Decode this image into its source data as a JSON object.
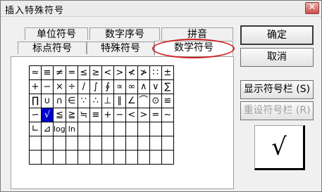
{
  "window": {
    "title": "插入特殊符号",
    "close_glyph": "✕"
  },
  "tabs": [
    {
      "label": "单位符号"
    },
    {
      "label": "数字序号"
    },
    {
      "label": "拼音"
    },
    {
      "label": "标点符号"
    },
    {
      "label": "特殊符号"
    },
    {
      "label": "数学符号",
      "active": true
    }
  ],
  "symbols": [
    [
      "≈",
      "≡",
      "≠",
      "=",
      "≤",
      "≥",
      "<",
      ">",
      "≮",
      "≯",
      "∷",
      "±"
    ],
    [
      "+",
      "−",
      "×",
      "÷",
      "/",
      "∫",
      "∮",
      "∝",
      "∞",
      "∧",
      "∨",
      "∑"
    ],
    [
      "∏",
      "∪",
      "∩",
      "∈",
      "∵",
      "∴",
      "⊥",
      "∥",
      "∠",
      "⌒",
      "⊙",
      "≌"
    ],
    [
      "∽",
      "√",
      "≦",
      "≧",
      "≒",
      "≡",
      "+",
      "−",
      "<",
      ">",
      "=",
      "∼"
    ],
    [
      "∟",
      "⊿",
      "log",
      "ln",
      "",
      "",
      "",
      "",
      "",
      "",
      "",
      ""
    ],
    [
      "",
      "",
      "",
      "",
      "",
      "",
      "",
      "",
      "",
      "",
      "",
      ""
    ],
    [
      "",
      "",
      "",
      "",
      "",
      "",
      "",
      "",
      "",
      "",
      "",
      ""
    ]
  ],
  "selected_symbol": "√",
  "buttons": {
    "ok": "确定",
    "cancel": "取消",
    "show_toolbar": "显示符号栏 (S)",
    "reset_toolbar": "重设符号栏 (R)"
  },
  "preview_symbol": "√",
  "colors": {
    "selection": "#0000cc",
    "annotation": "#d02020"
  }
}
